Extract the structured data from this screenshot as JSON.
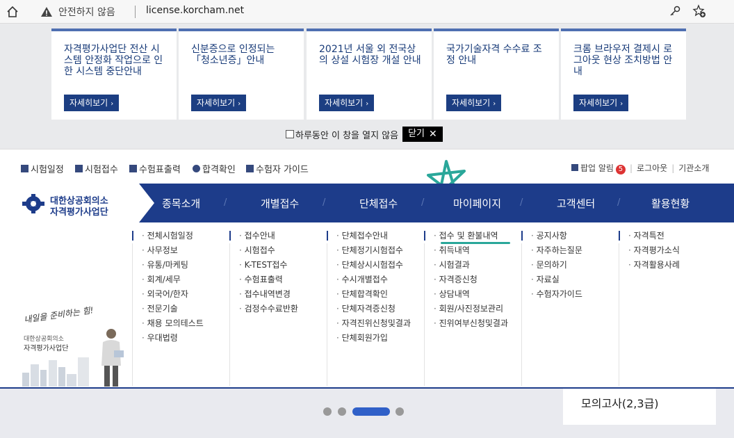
{
  "browser": {
    "security_label": "안전하지 않음",
    "url": "license.korcham.net"
  },
  "notices": [
    {
      "title": "자격평가사업단 전산 시스템 안정화 작업으로 인한 시스템 중단안내",
      "button": "자세히보기"
    },
    {
      "title": "신분증으로 인정되는 「청소년증」안내",
      "button": "자세히보기"
    },
    {
      "title": "2021년 서울 외 전국상의 상설 시험장 개설 안내",
      "button": "자세히보기"
    },
    {
      "title": "국가기술자격 수수료 조정 안내",
      "button": "자세히보기"
    },
    {
      "title": "크롬 브라우저 결제시 로그아웃 현상 조치방법 안내",
      "button": "자세히보기"
    }
  ],
  "popup": {
    "dont_show_label": "하루동안 이 창을 열지 않음",
    "close_label": "닫기"
  },
  "util": {
    "left": [
      "시험일정",
      "시험접수",
      "수험표출력",
      "합격확인",
      "수험자 가이드"
    ],
    "popup_alert": "팝업 알림",
    "popup_count": "5",
    "logout": "로그아웃",
    "org_intro": "기관소개"
  },
  "logo": {
    "line1": "대한상공회의소",
    "line2": "자격평가사업단"
  },
  "gnb": [
    "종목소개",
    "개별접수",
    "단체접수",
    "마이페이지",
    "고객센터",
    "활용현황"
  ],
  "mega": [
    [
      "전체시험일정",
      "사무정보",
      "유통/마케팅",
      "회계/세무",
      "외국어/한자",
      "전문기술",
      "채용 모의테스트",
      "우대법령"
    ],
    [
      "접수안내",
      "시험접수",
      "K-TEST접수",
      "수험표출력",
      "접수내역변경",
      "검정수수료반환"
    ],
    [
      "단체접수안내",
      "단체정기시험접수",
      "단체상시시험접수",
      "수시개별접수",
      "단체합격확인",
      "단체자격증신청",
      "자격진위신청및결과",
      "단체회원가입"
    ],
    [
      "접수 및 환불내역",
      "취득내역",
      "시험결과",
      "자격증신청",
      "상담내역",
      "회원/사진정보관리",
      "진위여부신청및결과"
    ],
    [
      "공지사항",
      "자주하는질문",
      "문의하기",
      "자료실",
      "수험자가이드"
    ],
    [
      "자격특전",
      "자격평가소식",
      "자격활용사례"
    ]
  ],
  "illustration": {
    "slogan": "내일을 준비하는 힘!",
    "org": "대한상공회의소",
    "name": "자격평가사업단"
  },
  "banner": {
    "text": "모의고사(2,3급)"
  }
}
